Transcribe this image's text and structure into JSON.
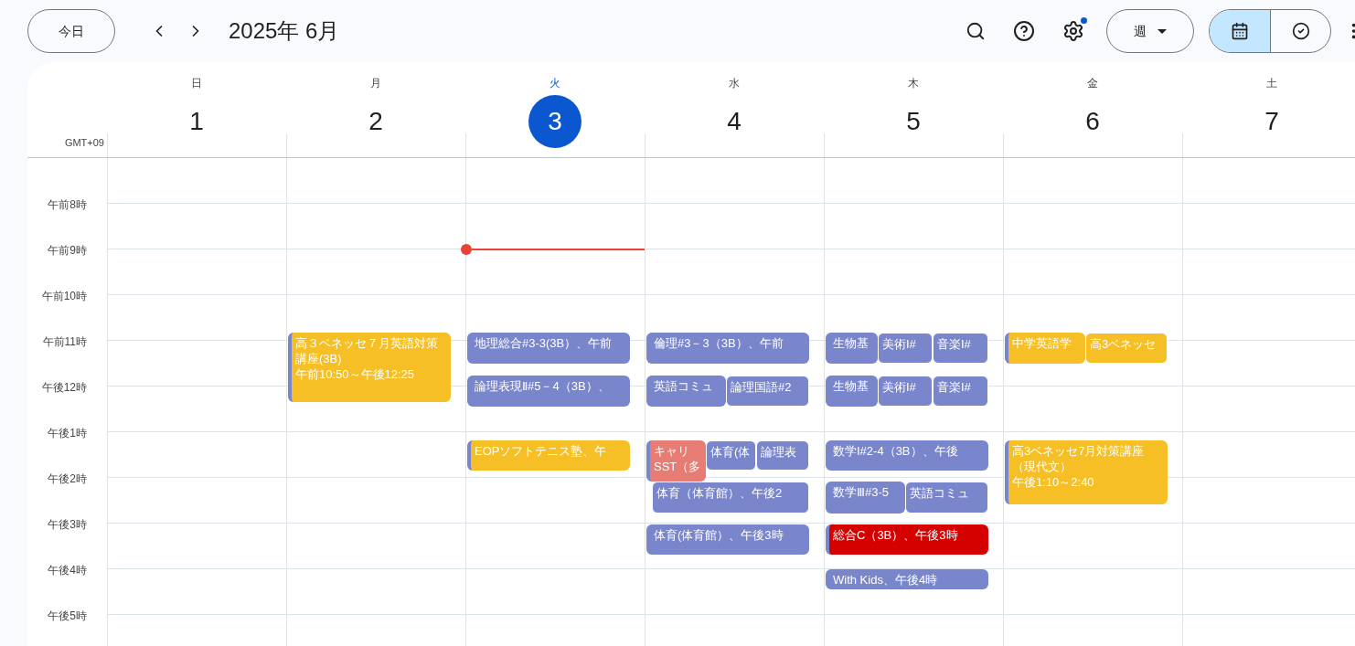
{
  "toolbar": {
    "today_button": "今日",
    "title": "2025年 6月",
    "settings_badge": true,
    "view_select": "週",
    "view_toggle": [
      {
        "kind": "calendar",
        "selected": true
      },
      {
        "kind": "tasks",
        "selected": false
      }
    ]
  },
  "timezone": "GMT+09",
  "hours": [
    "午前8時",
    "午前9時",
    "午前10時",
    "午前11時",
    "午後12時",
    "午後1時",
    "午後2時",
    "午後3時",
    "午後4時",
    "午後5時"
  ],
  "days": [
    {
      "weekday": "日",
      "date": "1",
      "selected": false
    },
    {
      "weekday": "月",
      "date": "2",
      "selected": false,
      "events": [
        {
          "lines": [
            "高３ベネッセ７月英語対策講座(3B)",
            "午前10:50～午後12:25"
          ],
          "color": "#f6bf26"
        }
      ]
    },
    {
      "weekday": "火",
      "date": "3",
      "selected": true,
      "events": [
        {
          "lines": [
            "地理総合#3-3(3B）、午前"
          ],
          "color": "#7986cb"
        },
        {
          "lines": [
            "論理表現Ⅱ#5－4（3B）、"
          ],
          "color": "#7986cb"
        },
        {
          "lines": [
            "EOPソフトテニス塾、午"
          ],
          "color": "#f6bf26"
        }
      ]
    },
    {
      "weekday": "水",
      "date": "4",
      "selected": false,
      "events": [
        {
          "lines": [
            "倫理#3－3（3B）、午前"
          ],
          "color": "#7986cb"
        },
        {
          "lines": [
            "英語コミュ"
          ],
          "color": "#7986cb"
        },
        {
          "lines": [
            "論理国語#2"
          ],
          "color": "#7986cb"
        },
        {
          "lines": [
            "キャリ",
            "SST（多"
          ],
          "color": "#e67c73"
        },
        {
          "lines": [
            "体育(体"
          ],
          "color": "#7986cb"
        },
        {
          "lines": [
            "論理表"
          ],
          "color": "#7986cb"
        },
        {
          "lines": [
            "体育（体育館）、午後2"
          ],
          "color": "#7986cb"
        },
        {
          "lines": [
            "体育(体育館）、午後3時"
          ],
          "color": "#7986cb"
        }
      ]
    },
    {
      "weekday": "木",
      "date": "5",
      "selected": false,
      "events": [
        {
          "lines": [
            "生物基"
          ],
          "color": "#7986cb"
        },
        {
          "lines": [
            "美術I#"
          ],
          "color": "#7986cb"
        },
        {
          "lines": [
            "音楽I#"
          ],
          "color": "#7986cb"
        },
        {
          "lines": [
            "生物基"
          ],
          "color": "#7986cb"
        },
        {
          "lines": [
            "美術I#"
          ],
          "color": "#7986cb"
        },
        {
          "lines": [
            "音楽I#"
          ],
          "color": "#7986cb"
        },
        {
          "lines": [
            "数学I#2-4（3B）、午後"
          ],
          "color": "#7986cb"
        },
        {
          "lines": [
            "数学Ⅲ#3-5"
          ],
          "color": "#7986cb"
        },
        {
          "lines": [
            "英語コミュ"
          ],
          "color": "#7986cb"
        },
        {
          "lines": [
            "総合C（3B）、午後3時"
          ],
          "color": "#d50000"
        },
        {
          "lines": [
            "With Kids、午後4時"
          ],
          "color": "#7986cb"
        }
      ]
    },
    {
      "weekday": "金",
      "date": "6",
      "selected": false,
      "events": [
        {
          "lines": [
            "中学英語学"
          ],
          "color": "#f6bf26"
        },
        {
          "lines": [
            "高3ベネッセ"
          ],
          "color": "#f6bf26"
        },
        {
          "lines": [
            "高3ベネッセ7月対策講座（現代文）",
            "午後1:10～2:40"
          ],
          "color": "#f6bf26"
        }
      ]
    },
    {
      "weekday": "土",
      "date": "7",
      "selected": false
    }
  ]
}
